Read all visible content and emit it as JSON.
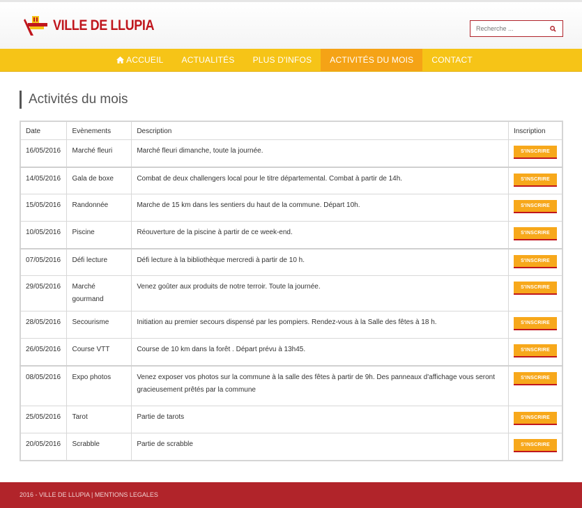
{
  "header": {
    "logo_text": "VILLE DE LLUPIA",
    "search_placeholder": "Recherche ..."
  },
  "nav": {
    "items": [
      {
        "label": "ACCUEIL",
        "icon": "home-icon",
        "active": false
      },
      {
        "label": "ACTUALITÉS",
        "active": false
      },
      {
        "label": "PLUS D'INFOS",
        "active": false
      },
      {
        "label": "ACTIVITÉS DU MOIS",
        "active": true
      },
      {
        "label": "CONTACT",
        "active": false
      }
    ]
  },
  "page": {
    "title": "Activités du mois"
  },
  "table": {
    "headers": [
      "Date",
      "Evènements",
      "Description",
      "Inscription"
    ],
    "button_label": "S'INSCRIRE",
    "rows": [
      {
        "date": "16/05/2016",
        "event": "Marché fleuri",
        "description": "Marché fleuri dimanche, toute la journée."
      },
      {
        "date": "14/05/2016",
        "event": "Gala de boxe",
        "description": "Combat de deux challengers local pour le titre départemental. Combat à partir de 14h."
      },
      {
        "date": "15/05/2016",
        "event": "Randonnée",
        "description": "Marche de 15 km dans les sentiers du haut de la commune. Départ 10h."
      },
      {
        "date": "10/05/2016",
        "event": "Piscine",
        "description": "Réouverture de la piscine à partir de ce week-end."
      },
      {
        "date": "07/05/2016",
        "event": "Défi lecture",
        "description": "Défi lecture à la bibliothèque mercredi à partir de 10 h."
      },
      {
        "date": "29/05/2016",
        "event": "Marché gourmand",
        "description": "Venez goûter aux produits de notre terroir. Toute la journée."
      },
      {
        "date": "28/05/2016",
        "event": "Secourisme",
        "description": "Initiation au premier secours dispensé par les pompiers. Rendez-vous à la Salle des fêtes à 18 h."
      },
      {
        "date": "26/05/2016",
        "event": "Course VTT",
        "description": "Course de 10 km dans la forêt . Départ prévu à 13h45."
      },
      {
        "date": "08/05/2016",
        "event": "Expo photos",
        "description": "Venez exposer vos photos sur la commune à la salle des fêtes à partir de 9h. Des panneaux d'affichage vous seront gracieusement prêtés par la commune"
      },
      {
        "date": "25/05/2016",
        "event": "Tarot",
        "description": "Partie de tarots"
      },
      {
        "date": "20/05/2016",
        "event": "Scrabble",
        "description": "Partie de scrabble"
      }
    ]
  },
  "footer": {
    "text": "2016 - VILLE DE LLUPIA | MENTIONS LEGALES"
  },
  "colors": {
    "brand_red": "#c0161d",
    "nav_yellow": "#f6c417",
    "nav_active": "#f5a316",
    "button_orange": "#f7a81b",
    "footer_red": "#b1242a"
  }
}
